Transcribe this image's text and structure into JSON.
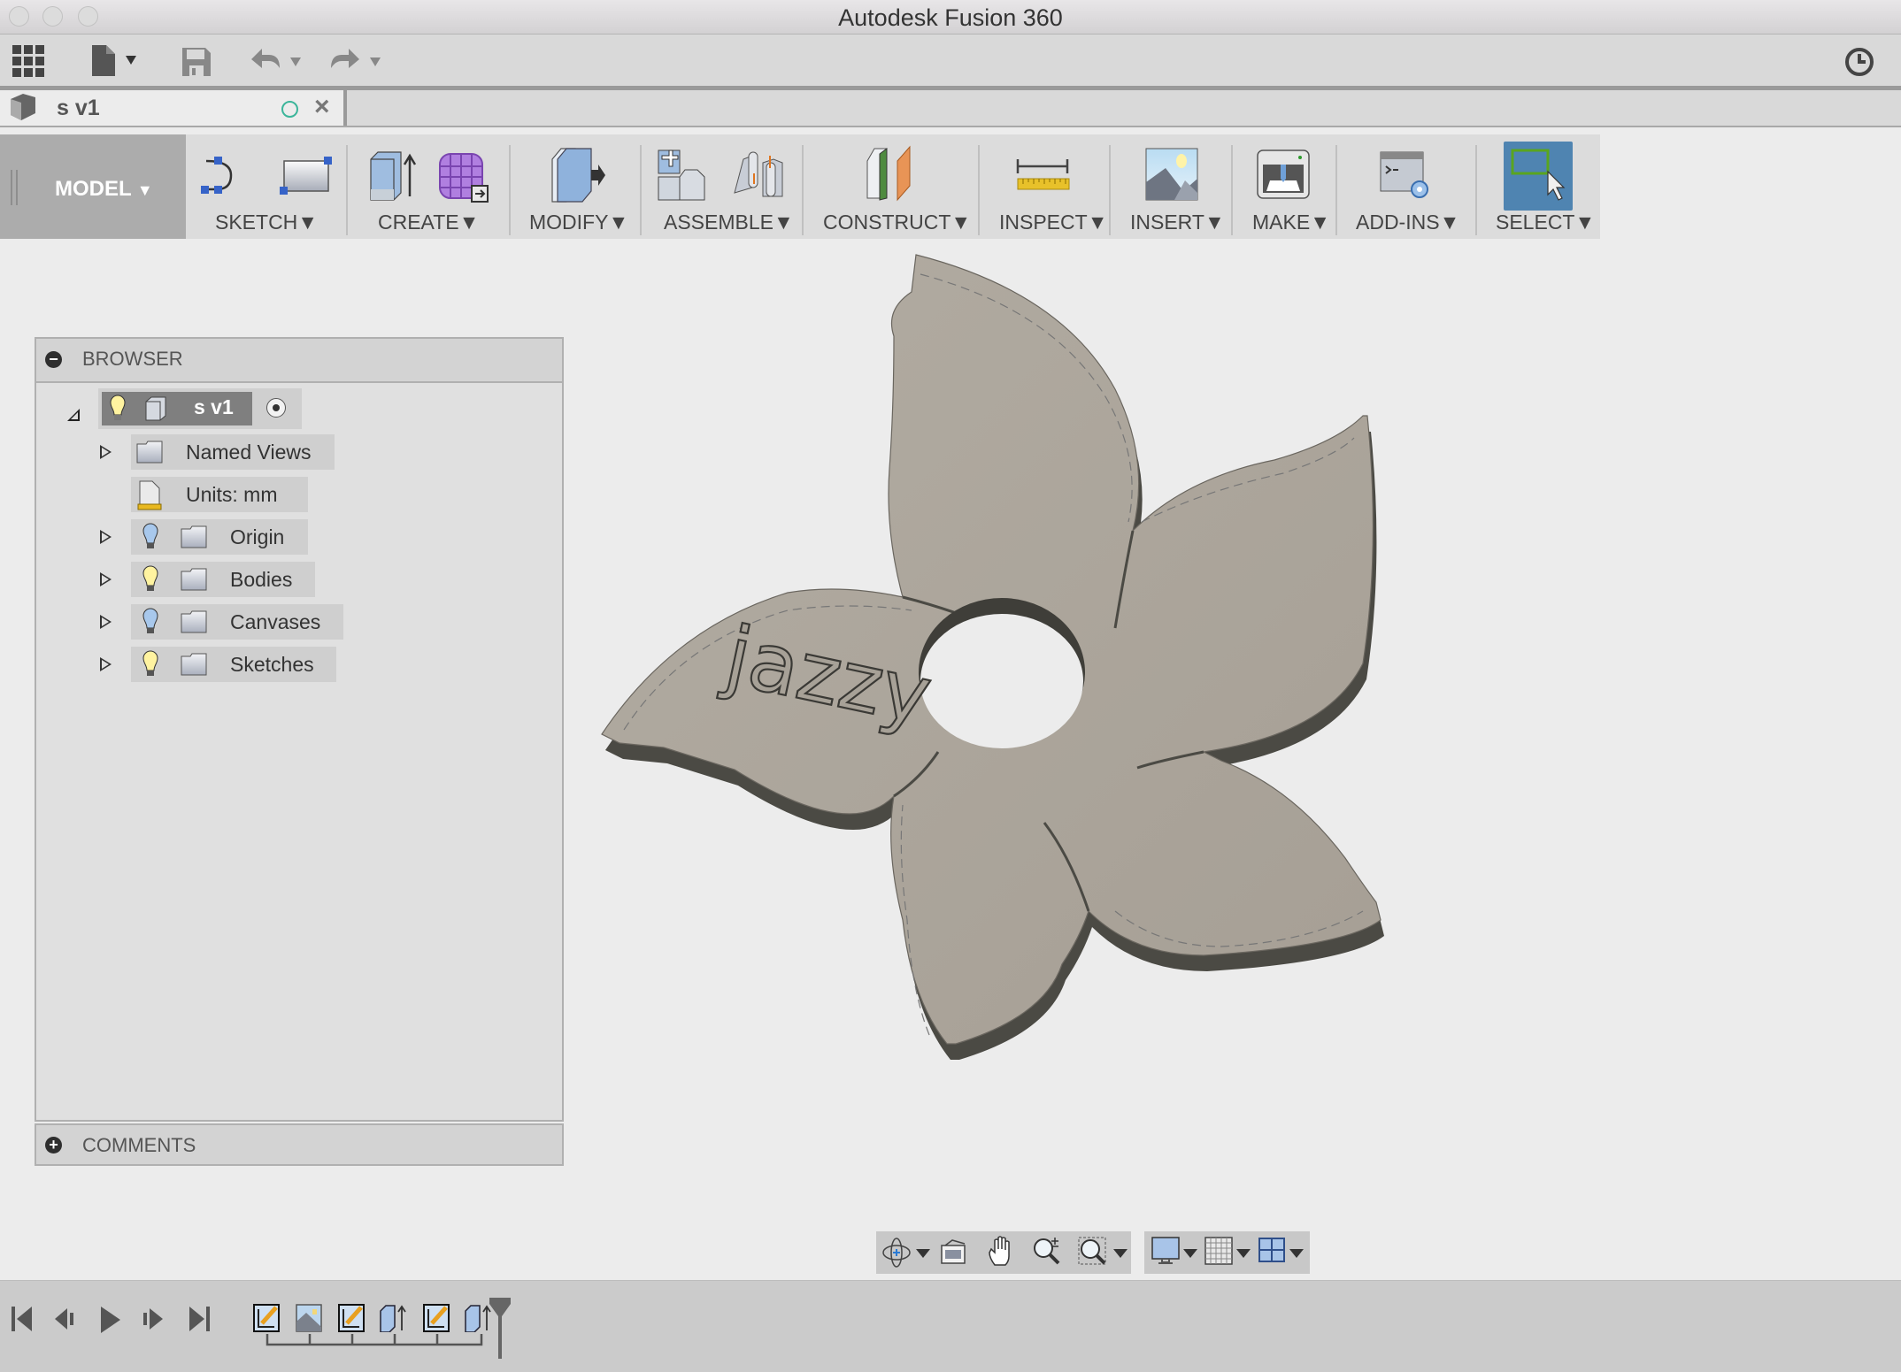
{
  "window": {
    "title": "Autodesk Fusion 360"
  },
  "quick_access": {
    "icons": [
      "data-panel-grid-icon",
      "file-menu-icon",
      "save-icon",
      "undo-icon",
      "redo-icon",
      "job-status-clock-icon"
    ]
  },
  "document_tab": {
    "label": "s v1",
    "status": "saved-circle",
    "close": "×"
  },
  "ribbon": {
    "workspace": "MODEL",
    "groups": [
      {
        "label": "SKETCH"
      },
      {
        "label": "CREATE"
      },
      {
        "label": "MODIFY"
      },
      {
        "label": "ASSEMBLE"
      },
      {
        "label": "CONSTRUCT"
      },
      {
        "label": "INSPECT"
      },
      {
        "label": "INSERT"
      },
      {
        "label": "MAKE"
      },
      {
        "label": "ADD-INS"
      },
      {
        "label": "SELECT"
      }
    ],
    "dropdown_caret": "▼",
    "select_active_color": "#4f84b1"
  },
  "browser": {
    "title": "BROWSER",
    "collapse_symbol": "−",
    "root": {
      "label": "s v1",
      "visible": true
    },
    "items": [
      {
        "label": "Named Views",
        "expandable": true,
        "bulb": null
      },
      {
        "label": "Units: mm",
        "expandable": false,
        "bulb": null
      },
      {
        "label": "Origin",
        "expandable": true,
        "bulb": "off"
      },
      {
        "label": "Bodies",
        "expandable": true,
        "bulb": "on"
      },
      {
        "label": "Canvases",
        "expandable": true,
        "bulb": "off"
      },
      {
        "label": "Sketches",
        "expandable": true,
        "bulb": "on"
      }
    ]
  },
  "comments": {
    "title": "COMMENTS",
    "expand_symbol": "+"
  },
  "viewport": {
    "model_text": "jazzy",
    "model_color": "#aea99f",
    "background": "#ececec"
  },
  "navbar": {
    "tools": [
      "orbit-icon",
      "look-at-icon",
      "pan-icon",
      "zoom-icon",
      "fit-window-icon",
      "display-settings-icon",
      "grid-icon",
      "viewports-icon"
    ]
  },
  "timeline": {
    "controls": [
      "go-to-start",
      "step-back",
      "play",
      "step-forward",
      "go-to-end"
    ],
    "features": [
      "sketch",
      "canvas",
      "sketch",
      "extrude",
      "sketch",
      "extrude"
    ]
  }
}
